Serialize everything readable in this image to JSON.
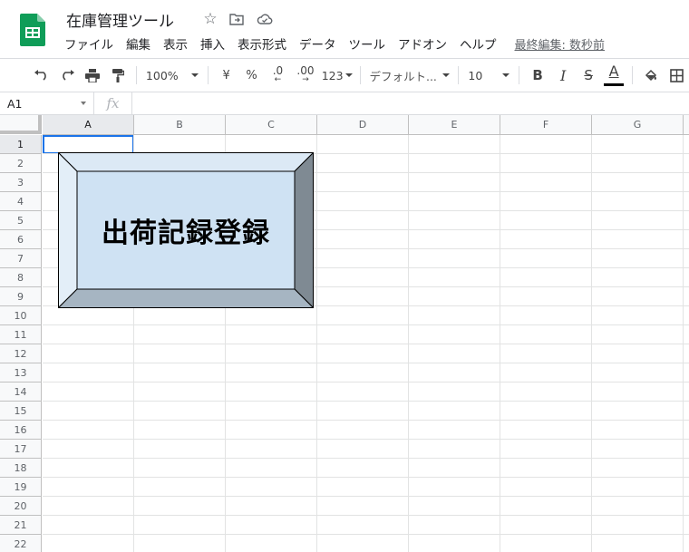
{
  "app": {
    "title": "在庫管理ツール",
    "last_edit": "最終編集: 数秒前"
  },
  "menu": [
    "ファイル",
    "編集",
    "表示",
    "挿入",
    "表示形式",
    "データ",
    "ツール",
    "アドオン",
    "ヘルプ"
  ],
  "toolbar": {
    "zoom": "100%",
    "currency": "¥",
    "percent": "%",
    "decrease_decimal": ".0",
    "increase_decimal": ".00",
    "more_formats": "123",
    "font": "デフォルト...",
    "font_size": "10",
    "bold": "B",
    "italic": "I",
    "strike": "S",
    "text_color": "A"
  },
  "formula_bar": {
    "name_box": "A1",
    "fx": "fx",
    "value": ""
  },
  "grid": {
    "columns": [
      "A",
      "B",
      "C",
      "D",
      "E",
      "F",
      "G"
    ],
    "rows": [
      "1",
      "2",
      "3",
      "4",
      "5",
      "6",
      "7",
      "8",
      "9",
      "10",
      "11",
      "12",
      "13",
      "14",
      "15",
      "16",
      "17",
      "18",
      "19",
      "20",
      "21",
      "22"
    ],
    "active_cell": "A1"
  },
  "shape_button": {
    "label": "出荷記録登録",
    "face_color": "#cfe2f3",
    "top_bevel_color": "#dce9f5",
    "left_bevel_color": "#e3eef8",
    "right_bevel_color": "#7f8a93",
    "bottom_bevel_color": "#a6b5c2"
  },
  "colors": {
    "accent": "#1a73e8",
    "sheets_green": "#0f9d58"
  }
}
